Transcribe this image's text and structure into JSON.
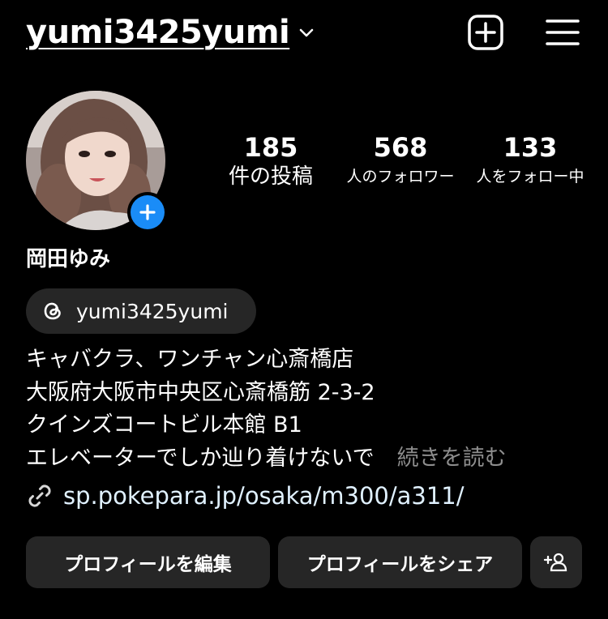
{
  "header": {
    "username": "yumi3425yumi",
    "icons": [
      "chevron-down-icon",
      "new-post-icon",
      "menu-icon"
    ]
  },
  "profile": {
    "display_name": "岡田ゆみ",
    "stats": [
      {
        "value": "185",
        "label": "件の投稿"
      },
      {
        "value": "568",
        "label": "人のフォロワー"
      },
      {
        "value": "133",
        "label": "人をフォロー中"
      }
    ],
    "threads_handle": "yumi3425yumi",
    "bio_lines": [
      "キャバクラ、ワンチャン心斎橋店",
      "大阪府大阪市中央区心斎橋筋 2-3-2",
      "クインズコートビル本館 B1",
      "エレベーターでしか辿り着けないで"
    ],
    "bio_more": "続きを読む",
    "link": "sp.pokepara.jp/osaka/m300/a311/"
  },
  "actions": {
    "edit_profile": "プロフィールを編集",
    "share_profile": "プロフィールをシェア"
  },
  "colors": {
    "background": "#000000",
    "button_bg": "#262626",
    "accent_blue": "#1a8cf7",
    "muted_text": "#8e8e8e",
    "link_text": "#e0f1ff"
  }
}
